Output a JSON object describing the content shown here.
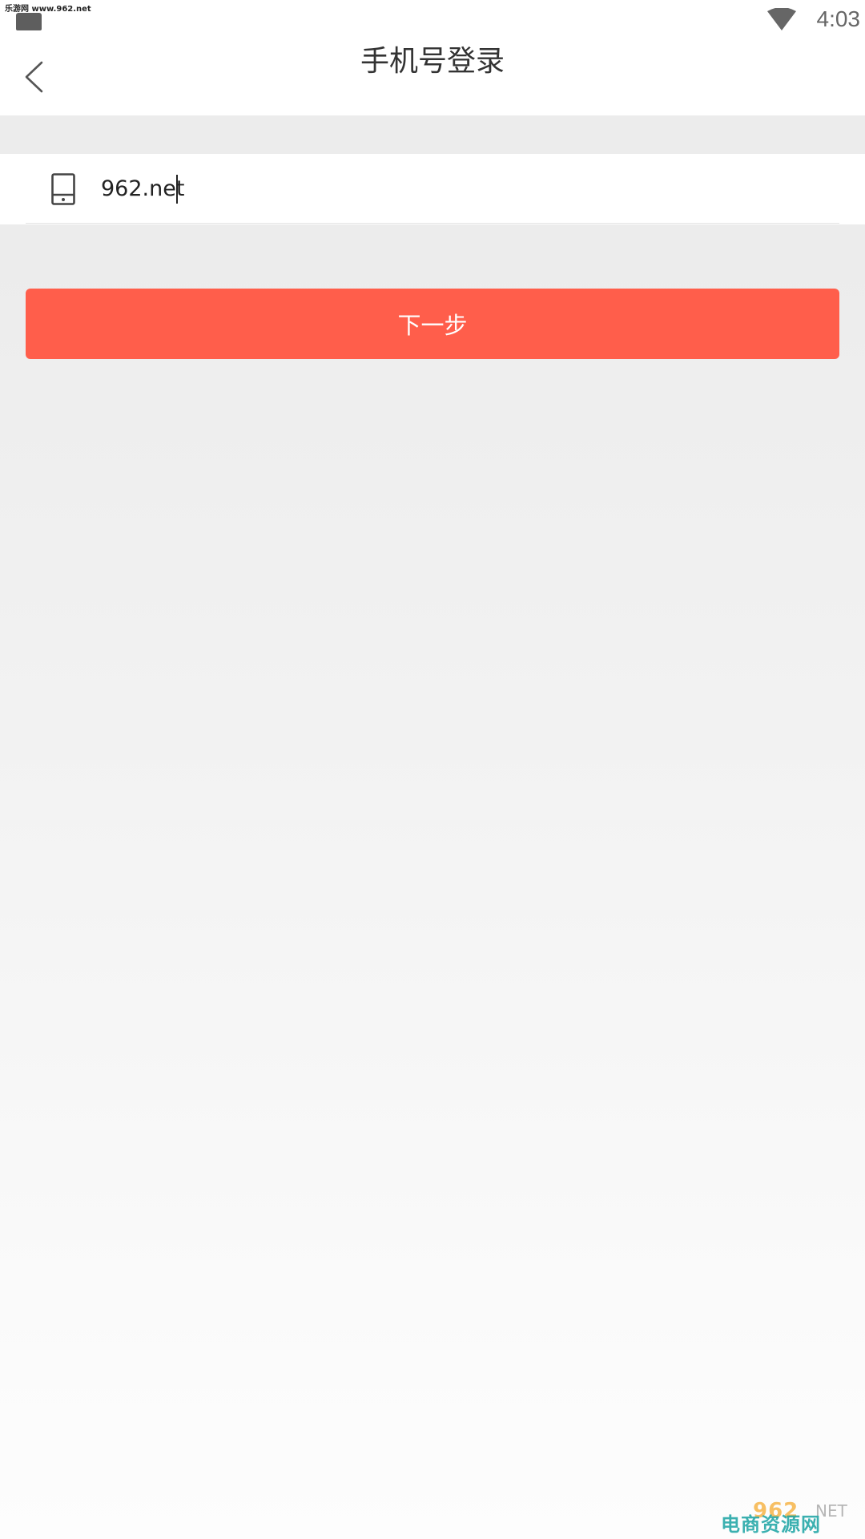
{
  "status_bar": {
    "watermark": "乐游网 www.962.net",
    "time": "4:03",
    "icons": [
      "notification-icon",
      "wifi-icon"
    ]
  },
  "header": {
    "title": "手机号登录",
    "back_icon": "back-chevron-icon"
  },
  "form": {
    "phone_icon": "phone-icon",
    "phone_value": "962.net"
  },
  "actions": {
    "next_label": "下一步"
  },
  "watermark_bottom": {
    "logo": "962",
    "logo_suffix": "NET",
    "text": "电商资源网"
  },
  "colors": {
    "accent": "#ff5e4b",
    "background": "#ececec",
    "text": "#333333"
  }
}
